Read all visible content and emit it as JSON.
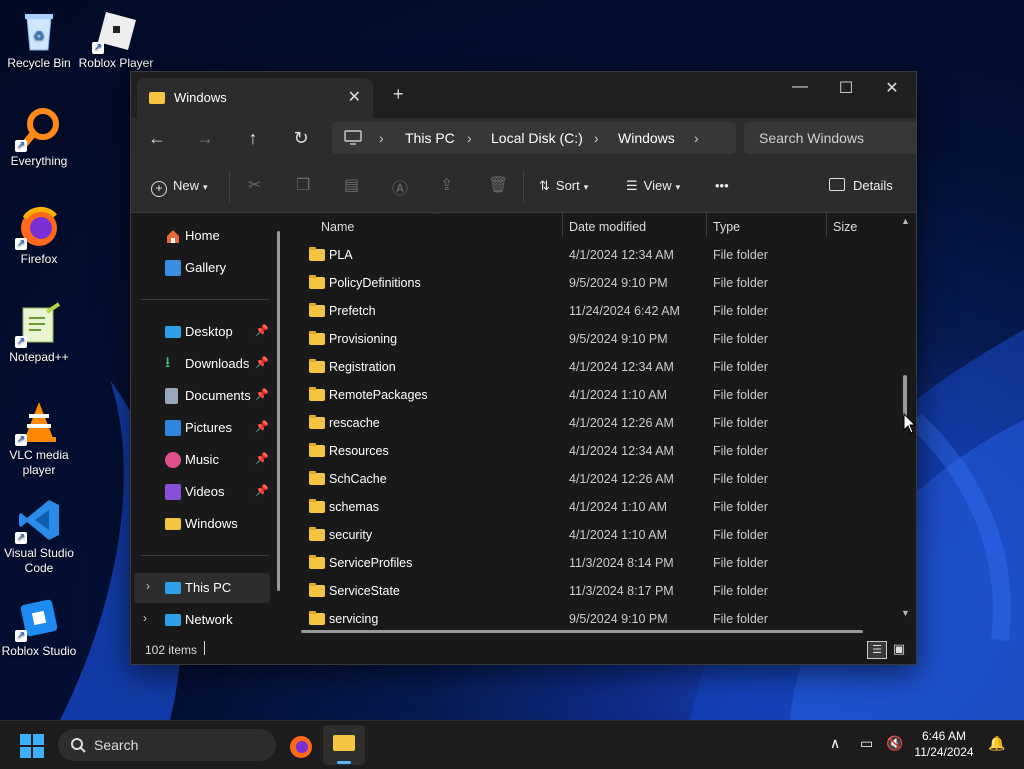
{
  "desktop": {
    "icons": [
      {
        "label": "Recycle Bin"
      },
      {
        "label": "Roblox Player"
      },
      {
        "label": "Everything"
      },
      {
        "label": "Firefox"
      },
      {
        "label": "Notepad++"
      },
      {
        "label": "VLC media player"
      },
      {
        "label": "Visual Studio Code"
      },
      {
        "label": "Roblox Studio"
      }
    ]
  },
  "window": {
    "tab_title": "Windows",
    "tab_close": "✕",
    "new_tab": "+",
    "controls": {
      "minimize": "—",
      "maximize": "☐",
      "close": "✕"
    },
    "nav": {
      "back": "←",
      "forward": "→",
      "up": "↑",
      "refresh": "↻"
    },
    "breadcrumb": [
      "This PC",
      "Local Disk (C:)",
      "Windows"
    ],
    "search_placeholder": "Search Windows",
    "toolbar": {
      "new": "New",
      "sort": "Sort",
      "view": "View",
      "more": "•••",
      "details": "Details"
    },
    "sidebar": {
      "items": [
        {
          "label": "Home"
        },
        {
          "label": "Gallery"
        },
        {
          "label": "Desktop"
        },
        {
          "label": "Downloads"
        },
        {
          "label": "Documents"
        },
        {
          "label": "Pictures"
        },
        {
          "label": "Music"
        },
        {
          "label": "Videos"
        },
        {
          "label": "Windows"
        },
        {
          "label": "This PC"
        },
        {
          "label": "Network"
        }
      ]
    },
    "columns": {
      "name": "Name",
      "date": "Date modified",
      "type": "Type",
      "size": "Size"
    },
    "rows": [
      {
        "name": "PLA",
        "date": "4/1/2024 12:34 AM",
        "type": "File folder"
      },
      {
        "name": "PolicyDefinitions",
        "date": "9/5/2024 9:10 PM",
        "type": "File folder"
      },
      {
        "name": "Prefetch",
        "date": "11/24/2024 6:42 AM",
        "type": "File folder"
      },
      {
        "name": "Provisioning",
        "date": "9/5/2024 9:10 PM",
        "type": "File folder"
      },
      {
        "name": "Registration",
        "date": "4/1/2024 12:34 AM",
        "type": "File folder"
      },
      {
        "name": "RemotePackages",
        "date": "4/1/2024 1:10 AM",
        "type": "File folder"
      },
      {
        "name": "rescache",
        "date": "4/1/2024 12:26 AM",
        "type": "File folder"
      },
      {
        "name": "Resources",
        "date": "4/1/2024 12:34 AM",
        "type": "File folder"
      },
      {
        "name": "SchCache",
        "date": "4/1/2024 12:26 AM",
        "type": "File folder"
      },
      {
        "name": "schemas",
        "date": "4/1/2024 1:10 AM",
        "type": "File folder"
      },
      {
        "name": "security",
        "date": "4/1/2024 1:10 AM",
        "type": "File folder"
      },
      {
        "name": "ServiceProfiles",
        "date": "11/3/2024 8:14 PM",
        "type": "File folder"
      },
      {
        "name": "ServiceState",
        "date": "11/3/2024 8:17 PM",
        "type": "File folder"
      },
      {
        "name": "servicing",
        "date": "9/5/2024 9:10 PM",
        "type": "File folder"
      }
    ],
    "status": "102 items"
  },
  "taskbar": {
    "search_label": "Search",
    "time": "6:46 AM",
    "date": "11/24/2024"
  },
  "colors": {
    "folder": "#f5c542",
    "accent": "#1a5fd1"
  }
}
